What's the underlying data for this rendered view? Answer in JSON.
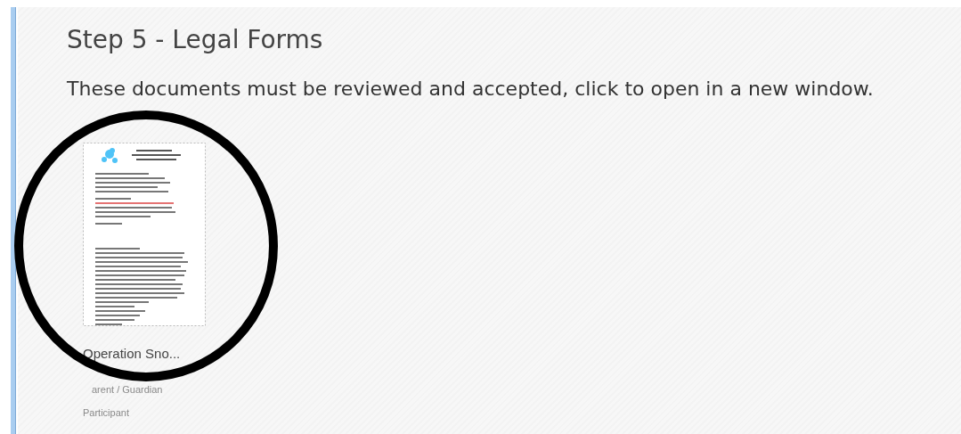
{
  "heading": "Step 5 - Legal Forms",
  "instructions": "These documents must be reviewed and accepted, click to open in a new window.",
  "documents": [
    {
      "name": "Operation Sno...",
      "signers": [
        "arent / Guardian",
        "Participant"
      ]
    }
  ]
}
